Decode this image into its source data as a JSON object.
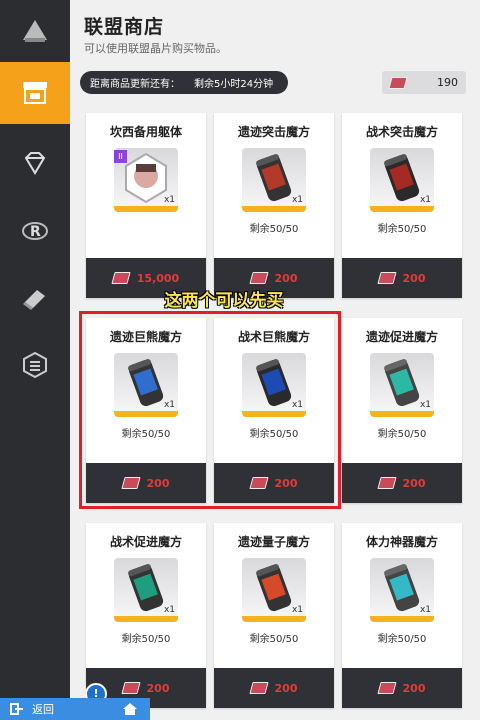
{
  "header": {
    "title": "联盟商店",
    "subtitle": "可以使用联盟晶片购买物品。",
    "timer_label": "距离商品更新还有：",
    "timer_value": "剩余5小时24分钟",
    "currency_amount": "190"
  },
  "sidebar": {
    "items": [
      {
        "icon": "ship-icon"
      },
      {
        "icon": "shop-icon",
        "active": true
      },
      {
        "icon": "diamond-icon"
      },
      {
        "icon": "r-logo-icon"
      },
      {
        "icon": "tag-icon"
      },
      {
        "icon": "hex-badge-icon"
      }
    ]
  },
  "annotation": {
    "caption": "这两个可以先买"
  },
  "items": [
    {
      "name": "坎西备用躯体",
      "qty": "x1",
      "stock": "",
      "price": "15,000",
      "badge": "II",
      "color": "#f0c9c2"
    },
    {
      "name": "遗迹突击魔方",
      "qty": "x1",
      "stock": "剩余50/50",
      "price": "200",
      "color": "#b33a2b"
    },
    {
      "name": "战术突击魔方",
      "qty": "x1",
      "stock": "剩余50/50",
      "price": "200",
      "color": "#a52a24"
    },
    {
      "name": "遗迹巨熊魔方",
      "qty": "x1",
      "stock": "剩余50/50",
      "price": "200",
      "color": "#2f6ecf"
    },
    {
      "name": "战术巨熊魔方",
      "qty": "x1",
      "stock": "剩余50/50",
      "price": "200",
      "color": "#1c4bb3"
    },
    {
      "name": "遗迹促进魔方",
      "qty": "x1",
      "stock": "剩余50/50",
      "price": "200",
      "color": "#2cb7a6"
    },
    {
      "name": "战术促进魔方",
      "qty": "x1",
      "stock": "剩余50/50",
      "price": "200",
      "color": "#1f9e7f"
    },
    {
      "name": "遗迹量子魔方",
      "qty": "x1",
      "stock": "剩余50/50",
      "price": "200",
      "color": "#d64a2a"
    },
    {
      "name": "体力神器魔方",
      "qty": "x1",
      "stock": "剩余50/50",
      "price": "200",
      "color": "#35b8c7"
    }
  ],
  "footer": {
    "back_label": "返回",
    "alert_label": "!"
  }
}
